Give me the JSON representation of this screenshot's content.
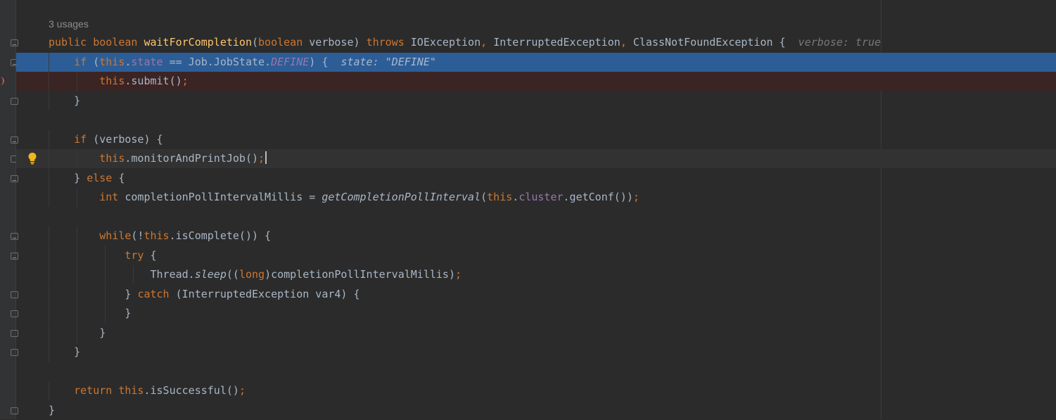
{
  "editor": {
    "usages_label": "3 usages",
    "colors": {
      "background": "#2b2b2b",
      "execution_line": "#2d5d96",
      "breakpoint_line": "#3b2424",
      "keyword": "#cc7832",
      "function": "#ffc66d",
      "field": "#9876aa",
      "text": "#a9b7c6",
      "inline_hint": "#787878",
      "bulb": "#f0b520"
    },
    "lines": [
      {
        "state": "normal",
        "tokens": [
          {
            "t": "public ",
            "c": "kw"
          },
          {
            "t": "boolean ",
            "c": "kw"
          },
          {
            "t": "waitForCompletion",
            "c": "fn"
          },
          {
            "t": "(",
            "c": "plain"
          },
          {
            "t": "boolean ",
            "c": "kw"
          },
          {
            "t": "verbose) ",
            "c": "plain"
          },
          {
            "t": "throws ",
            "c": "kw"
          },
          {
            "t": "IOException",
            "c": "plain"
          },
          {
            "t": ", ",
            "c": "kw"
          },
          {
            "t": "InterruptedException",
            "c": "plain"
          },
          {
            "t": ", ",
            "c": "kw"
          },
          {
            "t": "ClassNotFoundException {",
            "c": "plain"
          }
        ],
        "hint": "verbose: true"
      },
      {
        "state": "exec",
        "tokens": [
          {
            "t": "    ",
            "c": "plain"
          },
          {
            "t": "if ",
            "c": "kw"
          },
          {
            "t": "(",
            "c": "plain"
          },
          {
            "t": "this",
            "c": "kw"
          },
          {
            "t": ".",
            "c": "plain"
          },
          {
            "t": "state",
            "c": "field"
          },
          {
            "t": " == Job.JobState.",
            "c": "plain"
          },
          {
            "t": "DEFINE",
            "c": "const"
          },
          {
            "t": ") {",
            "c": "plain"
          }
        ],
        "hint": "state: \"DEFINE\""
      },
      {
        "state": "bp",
        "tokens": [
          {
            "t": "        ",
            "c": "plain"
          },
          {
            "t": "this",
            "c": "kw"
          },
          {
            "t": ".submit()",
            "c": "plain"
          },
          {
            "t": ";",
            "c": "kw"
          }
        ]
      },
      {
        "state": "normal",
        "tokens": [
          {
            "t": "    }",
            "c": "plain"
          }
        ]
      },
      {
        "state": "normal",
        "tokens": []
      },
      {
        "state": "normal",
        "tokens": [
          {
            "t": "    ",
            "c": "plain"
          },
          {
            "t": "if ",
            "c": "kw"
          },
          {
            "t": "(verbose) {",
            "c": "plain"
          }
        ]
      },
      {
        "state": "caret",
        "tokens": [
          {
            "t": "        ",
            "c": "plain"
          },
          {
            "t": "this",
            "c": "kw"
          },
          {
            "t": ".monitorAndPrintJob()",
            "c": "plain"
          },
          {
            "t": ";",
            "c": "kw"
          }
        ]
      },
      {
        "state": "normal",
        "tokens": [
          {
            "t": "    } ",
            "c": "plain"
          },
          {
            "t": "else ",
            "c": "kw"
          },
          {
            "t": "{",
            "c": "plain"
          }
        ]
      },
      {
        "state": "normal",
        "tokens": [
          {
            "t": "        ",
            "c": "plain"
          },
          {
            "t": "int ",
            "c": "kw"
          },
          {
            "t": "completionPollIntervalMillis = ",
            "c": "plain"
          },
          {
            "t": "getCompletionPollInterval",
            "c": "static"
          },
          {
            "t": "(",
            "c": "plain"
          },
          {
            "t": "this",
            "c": "kw"
          },
          {
            "t": ".",
            "c": "plain"
          },
          {
            "t": "cluster",
            "c": "field"
          },
          {
            "t": ".getConf())",
            "c": "plain"
          },
          {
            "t": ";",
            "c": "kw"
          }
        ]
      },
      {
        "state": "normal",
        "tokens": []
      },
      {
        "state": "normal",
        "tokens": [
          {
            "t": "        ",
            "c": "plain"
          },
          {
            "t": "while",
            "c": "kw"
          },
          {
            "t": "(!",
            "c": "plain"
          },
          {
            "t": "this",
            "c": "kw"
          },
          {
            "t": ".isComplete()) {",
            "c": "plain"
          }
        ]
      },
      {
        "state": "normal",
        "tokens": [
          {
            "t": "            ",
            "c": "plain"
          },
          {
            "t": "try ",
            "c": "kw"
          },
          {
            "t": "{",
            "c": "plain"
          }
        ]
      },
      {
        "state": "normal",
        "tokens": [
          {
            "t": "                Thread.",
            "c": "plain"
          },
          {
            "t": "sleep",
            "c": "static"
          },
          {
            "t": "((",
            "c": "plain"
          },
          {
            "t": "long",
            "c": "kw"
          },
          {
            "t": ")completionPollIntervalMillis)",
            "c": "plain"
          },
          {
            "t": ";",
            "c": "kw"
          }
        ]
      },
      {
        "state": "normal",
        "tokens": [
          {
            "t": "            } ",
            "c": "plain"
          },
          {
            "t": "catch ",
            "c": "kw"
          },
          {
            "t": "(InterruptedException var4) {",
            "c": "plain"
          }
        ]
      },
      {
        "state": "normal",
        "tokens": [
          {
            "t": "            }",
            "c": "plain"
          }
        ]
      },
      {
        "state": "normal",
        "tokens": [
          {
            "t": "        }",
            "c": "plain"
          }
        ]
      },
      {
        "state": "normal",
        "tokens": [
          {
            "t": "    }",
            "c": "plain"
          }
        ]
      },
      {
        "state": "normal",
        "tokens": []
      },
      {
        "state": "normal",
        "tokens": [
          {
            "t": "    ",
            "c": "plain"
          },
          {
            "t": "return ",
            "c": "kw"
          },
          {
            "t": "this",
            "c": "kw"
          },
          {
            "t": ".isSuccessful()",
            "c": "plain"
          },
          {
            "t": ";",
            "c": "kw"
          }
        ]
      },
      {
        "state": "normal",
        "tokens": [
          {
            "t": "}",
            "c": "plain"
          }
        ]
      }
    ]
  },
  "gutter": {
    "fold_marker_icon": "fold-marker-icon",
    "breakpoint_icon": "breakpoint-icon",
    "intention_icon": "lightbulb-icon"
  }
}
